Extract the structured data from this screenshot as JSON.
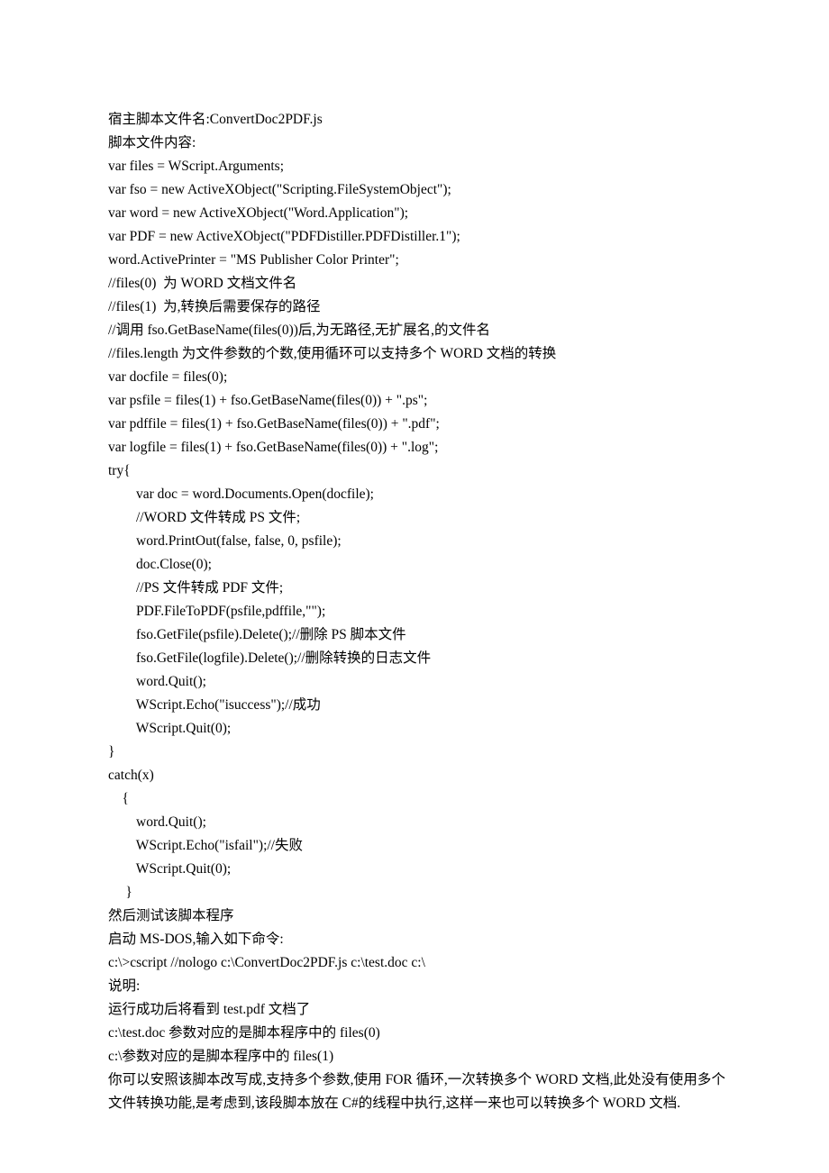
{
  "lines": [
    "宿主脚本文件名:ConvertDoc2PDF.js",
    "脚本文件内容:",
    "var files = WScript.Arguments;",
    "var fso = new ActiveXObject(\"Scripting.FileSystemObject\");",
    "var word = new ActiveXObject(\"Word.Application\");",
    "var PDF = new ActiveXObject(\"PDFDistiller.PDFDistiller.1\");",
    "word.ActivePrinter = \"MS Publisher Color Printer\";",
    "//files(0)  为 WORD 文档文件名",
    "//files(1)  为,转换后需要保存的路径",
    "//调用 fso.GetBaseName(files(0))后,为无路径,无扩展名,的文件名",
    "//files.length 为文件参数的个数,使用循环可以支持多个 WORD 文档的转换",
    "var docfile = files(0);",
    "var psfile = files(1) + fso.GetBaseName(files(0)) + \".ps\";",
    "var pdffile = files(1) + fso.GetBaseName(files(0)) + \".pdf\";",
    "var logfile = files(1) + fso.GetBaseName(files(0)) + \".log\";",
    "try{",
    "        var doc = word.Documents.Open(docfile);",
    "        //WORD 文件转成 PS 文件;",
    "        word.PrintOut(false, false, 0, psfile);",
    "        doc.Close(0);",
    "        //PS 文件转成 PDF 文件;",
    "        PDF.FileToPDF(psfile,pdffile,\"\");",
    "        fso.GetFile(psfile).Delete();//删除 PS 脚本文件",
    "        fso.GetFile(logfile).Delete();//删除转换的日志文件",
    "        word.Quit();",
    "        WScript.Echo(\"isuccess\");//成功",
    "        WScript.Quit(0);",
    "}",
    "catch(x)",
    "    {",
    "        word.Quit();",
    "        WScript.Echo(\"isfail\");//失败",
    "        WScript.Quit(0);",
    "     }",
    "然后测试该脚本程序",
    "启动 MS-DOS,输入如下命令:",
    "c:\\>cscript //nologo c:\\ConvertDoc2PDF.js c:\\test.doc c:\\",
    "说明:",
    "运行成功后将看到 test.pdf 文档了",
    "c:\\test.doc 参数对应的是脚本程序中的 files(0)",
    "c:\\参数对应的是脚本程序中的 files(1)",
    "你可以安照该脚本改写成,支持多个参数,使用 FOR 循环,一次转换多个 WORD 文档,此处没有使用多个文件转换功能,是考虑到,该段脚本放在 C#的线程中执行,这样一来也可以转换多个 WORD 文档."
  ]
}
